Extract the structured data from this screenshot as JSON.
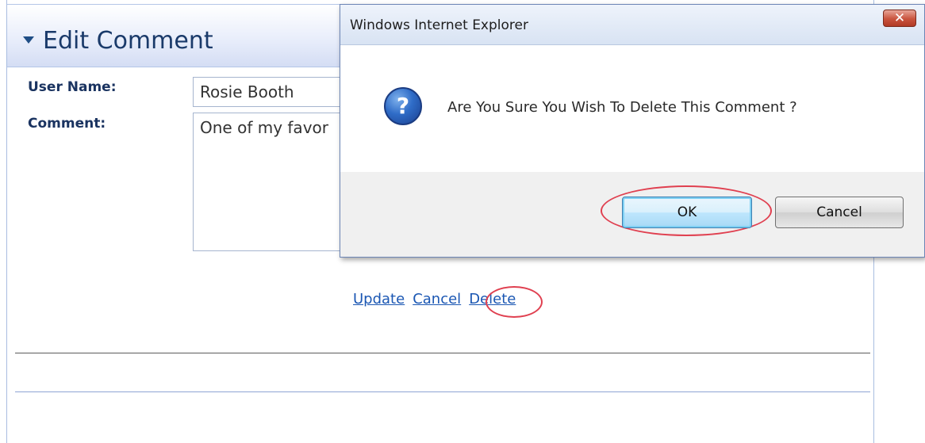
{
  "panel": {
    "title": "Edit Comment",
    "fields": {
      "username_label": "User Name:",
      "username_value": "Rosie Booth",
      "comment_label": "Comment:",
      "comment_value": "One of my favor"
    },
    "links": {
      "update": "Update",
      "cancel": "Cancel",
      "delete": "Delete"
    }
  },
  "dialog": {
    "title": "Windows Internet Explorer",
    "close_label": "✕",
    "icon": "question-icon",
    "message": "Are You Sure You Wish To Delete This Comment ?",
    "ok_label": "OK",
    "cancel_label": "Cancel"
  },
  "colors": {
    "highlight_ring": "#e04050",
    "link": "#1b57b3",
    "header_text": "#1a3a6a"
  }
}
